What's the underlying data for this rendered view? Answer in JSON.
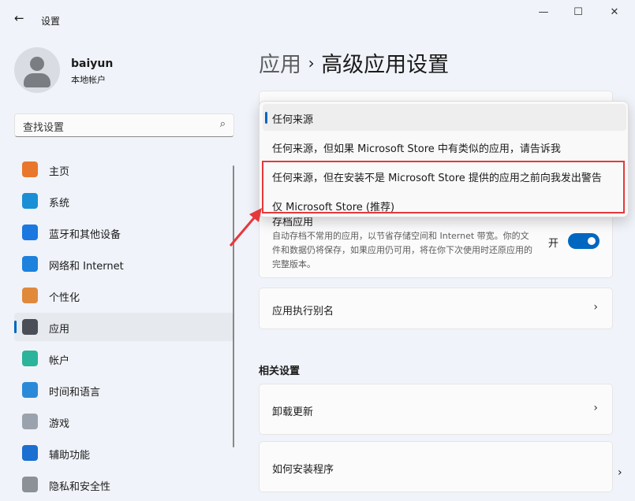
{
  "window": {
    "title": "设置",
    "back_icon": "arrow-left-icon",
    "minimize": "—",
    "maximize": "☐",
    "close": "✕"
  },
  "user": {
    "name": "baiyun",
    "type": "本地帐户"
  },
  "search": {
    "placeholder": "查找设置",
    "icon": "⌕"
  },
  "nav": [
    {
      "label": "主页",
      "color": "#e8762d"
    },
    {
      "label": "系统",
      "color": "#1b8fd6"
    },
    {
      "label": "蓝牙和其他设备",
      "color": "#1a78e0"
    },
    {
      "label": "网络和 Internet",
      "color": "#1c82dd"
    },
    {
      "label": "个性化",
      "color": "#e0893b"
    },
    {
      "label": "应用",
      "color": "#4a4f57",
      "selected": true
    },
    {
      "label": "帐户",
      "color": "#2bb39b"
    },
    {
      "label": "时间和语言",
      "color": "#2b8ad8"
    },
    {
      "label": "游戏",
      "color": "#9aa3ad"
    },
    {
      "label": "辅助功能",
      "color": "#1a6fd0"
    },
    {
      "label": "隐私和安全性",
      "color": "#8c9197"
    }
  ],
  "header": {
    "parent": "应用",
    "separator": "›",
    "title": "高级应用设置"
  },
  "dropdown": {
    "options": [
      "任何来源",
      "任何来源，但如果 Microsoft Store 中有类似的应用，请告诉我",
      "任何来源，但在安装不是 Microsoft Store 提供的应用之前向我发出警告",
      "仅 Microsoft Store (推荐)"
    ],
    "selected": 0
  },
  "archive": {
    "title": "存档应用",
    "desc": "自动存档不常用的应用，以节省存储空间和 Internet 带宽。你的文件和数据仍将保存，如果应用仍可用，将在你下次使用时还原应用的完整版本。",
    "state": "开",
    "on": true
  },
  "alias": {
    "label": "应用执行别名"
  },
  "related": {
    "title": "相关设置",
    "items": [
      "卸载更新",
      "如何安装程序"
    ]
  },
  "accent": "#0067c0",
  "highlight": "#e5383b"
}
